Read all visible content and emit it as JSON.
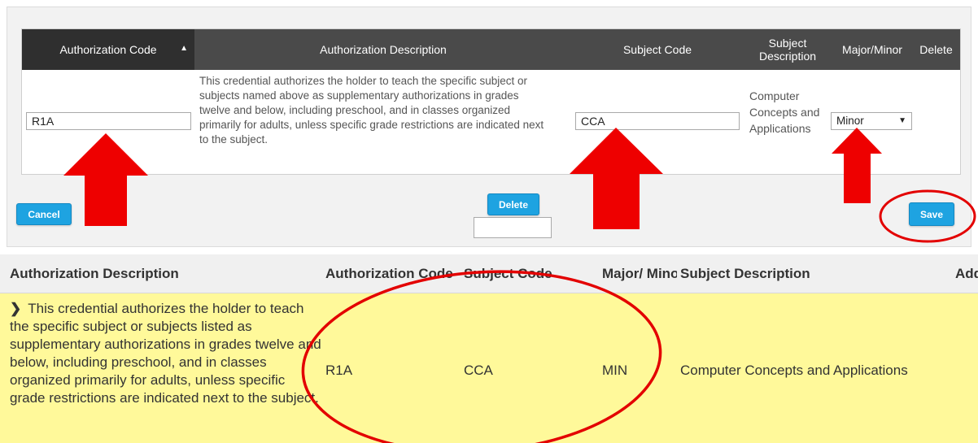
{
  "edit_grid": {
    "headers": {
      "authorization_code": "Authorization Code",
      "authorization_description": "Authorization Description",
      "subject_code": "Subject Code",
      "subject_description": "Subject Description",
      "major_minor": "Major/Minor",
      "delete": "Delete"
    },
    "sort_indicator": "▲",
    "row": {
      "authorization_code": "R1A",
      "authorization_description": "This credential authorizes the holder to teach the specific subject or subjects named above as supplementary authorizations in grades twelve and below, including preschool, and in classes organized primarily for adults, unless specific grade restrictions are indicated next to the subject.",
      "subject_code": "CCA",
      "subject_description": "Computer Concepts and Applications",
      "major_minor": "Minor"
    },
    "buttons": {
      "cancel": "Cancel",
      "delete": "Delete",
      "save": "Save"
    }
  },
  "result_table": {
    "headers": {
      "authorization_description": "Authorization Description",
      "authorization_code": "Authorization Code",
      "subject_code": "Subject Code",
      "major_minor": "Major/ Minor",
      "subject_description": "Subject Description",
      "added": "Added"
    },
    "row": {
      "expander": "❯",
      "authorization_description": "This credential authorizes the holder to teach the specific subject or subjects listed as supplementary authorizations in grades twelve and below, including preschool, and in classes organized primarily for adults, unless specific grade restrictions are indicated next to the subject.",
      "authorization_code": "R1A",
      "subject_code": "CCA",
      "major_minor": "MIN",
      "subject_description": "Computer Concepts and Applications"
    },
    "row_color": "#fff99a"
  },
  "annotations": {
    "arrow_color": "#ee0000",
    "circle_color": "#e30000"
  }
}
